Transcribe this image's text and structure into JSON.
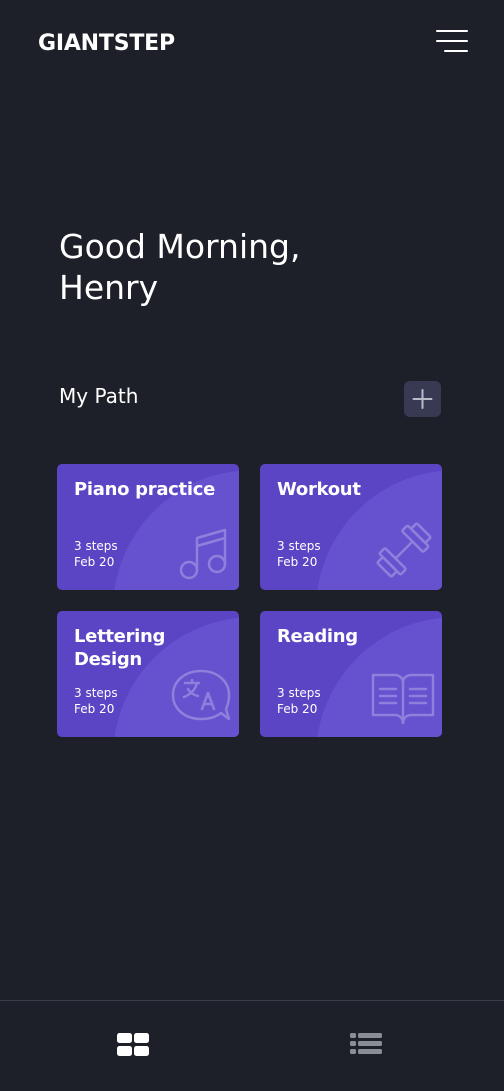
{
  "app": {
    "logo": "GIANTSTEP"
  },
  "header": {
    "menu_icon": "hamburger-menu-icon"
  },
  "greeting": {
    "line1": "Good Morning,",
    "line2": "Henry"
  },
  "path": {
    "title": "My Path",
    "add_icon": "plus-icon"
  },
  "cards": [
    {
      "title": "Piano practice",
      "steps": "3 steps",
      "date": "Feb 20",
      "icon": "music-note-icon"
    },
    {
      "title": "Workout",
      "steps": "3 steps",
      "date": "Feb 20",
      "icon": "dumbbell-icon"
    },
    {
      "title": "Lettering Design",
      "steps": "3 steps",
      "date": "Feb 20",
      "icon": "translate-icon"
    },
    {
      "title": "Reading",
      "steps": "3 steps",
      "date": "Feb 20",
      "icon": "open-book-icon"
    }
  ],
  "bottom_nav": {
    "items": [
      {
        "icon": "dashboard-grid-icon",
        "active": true
      },
      {
        "icon": "list-icon",
        "active": false
      }
    ]
  },
  "colors": {
    "background": "#1e2029",
    "card": "#5b45c4",
    "card_accent": "#6651cf",
    "add_button": "#373a52",
    "inactive_nav": "#8a8c96"
  }
}
